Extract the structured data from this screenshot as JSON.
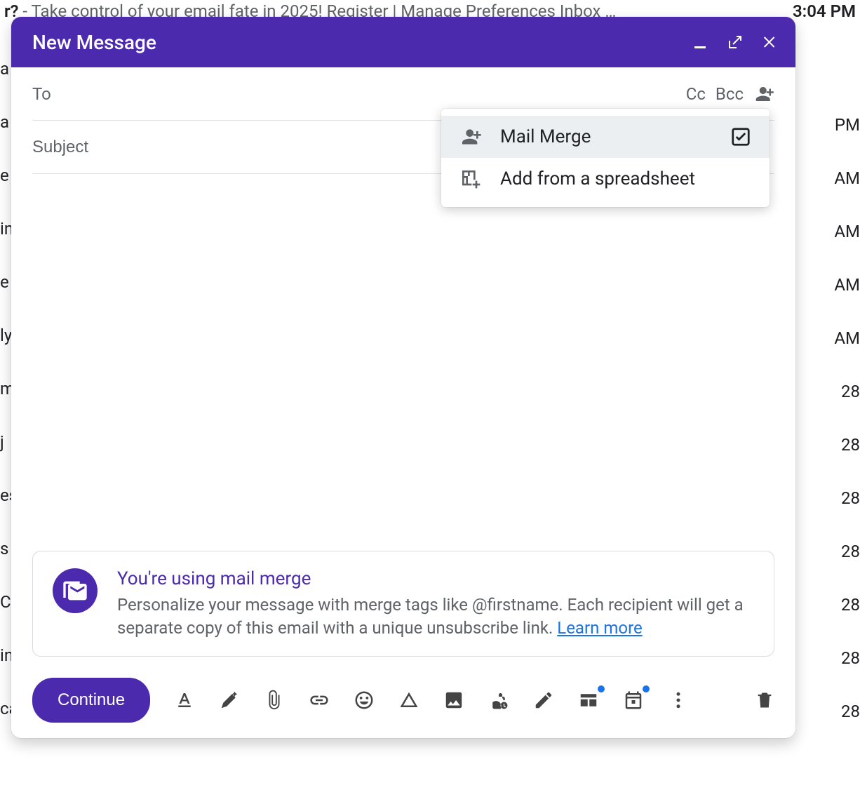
{
  "background": {
    "snippet_bold": "r?",
    "snippet_rest": " - Take control of your email fate in 2025! Register | Manage Preferences Inbox …",
    "time": "3:04 PM",
    "left_fragments": [
      "a",
      "a",
      "e",
      "in",
      "e",
      "ly",
      "m",
      "j",
      "es",
      "s",
      "C",
      "in",
      "ca"
    ],
    "right_fragments": [
      "PM",
      "AM",
      "AM",
      "AM",
      "AM",
      "28",
      "28",
      "28",
      "28",
      "28",
      "28",
      "28"
    ]
  },
  "compose": {
    "title": "New Message",
    "to_label": "To",
    "subject_placeholder": "Subject",
    "cc_label": "Cc",
    "bcc_label": "Bcc"
  },
  "menu": {
    "items": [
      {
        "label": "Mail Merge",
        "checked": true
      },
      {
        "label": "Add from a spreadsheet",
        "checked": false
      }
    ]
  },
  "info": {
    "title": "You're using mail merge",
    "body_a": "Personalize your message with merge tags like @firstname. Each recipient will get a separate copy of this email with a unique unsubscribe link. ",
    "link": "Learn more"
  },
  "toolbar": {
    "primary": "Continue"
  }
}
